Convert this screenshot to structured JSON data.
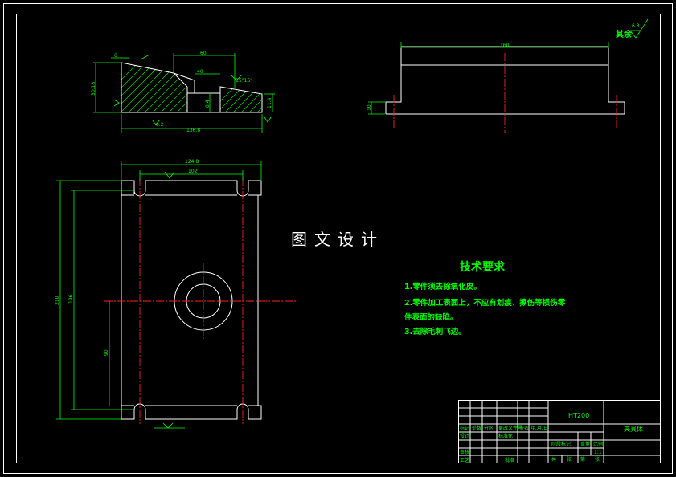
{
  "watermark": "图文设计",
  "tech_requirements": {
    "title": "技术要求",
    "items": [
      "1.零件须去除氧化皮。",
      "2.零件加工表面上，不应有划痕、擦伤等损伤零",
      "件表面的缺陷。",
      "3.去除毛刺飞边。"
    ]
  },
  "roughness_note": {
    "label": "其余",
    "value": "6.3"
  },
  "title_block": {
    "material": "HT200",
    "part_name": "夹具体",
    "row1": [
      "标记",
      "处数",
      "分区",
      "更改文件号",
      "签名",
      "年.月.日"
    ],
    "designer": "设计",
    "standardize": "标准化",
    "checker": "审核",
    "process": "工艺",
    "approve": "批准",
    "stage_mark": "阶段标记",
    "weight": "重量",
    "scale": "比例",
    "scale_value": "1:1",
    "sheets_total": "共",
    "sheets_label": "张",
    "sheet_no": "第",
    "sheet_label": "张"
  },
  "dimensions": {
    "front_overall_width": "136.8",
    "front_top_width": "60",
    "front_inner_width": "40",
    "front_left_height": "30.18",
    "front_right_height": "11.4",
    "front_slot_depth": "8.4",
    "front_angle": "15°16'",
    "front_offset": "6",
    "front_tolerance": "0.2",
    "plan_overall_width": "124.8",
    "plan_slot_spacing": "102",
    "plan_overall_height": "210",
    "plan_inner_height": "196",
    "plan_hole_offset": "90",
    "side_length": "160",
    "side_height": "10"
  },
  "colors": {
    "outline": "#ffffff",
    "dimension": "#00ff00",
    "centerline": "#ff2020",
    "background": "#000000"
  }
}
